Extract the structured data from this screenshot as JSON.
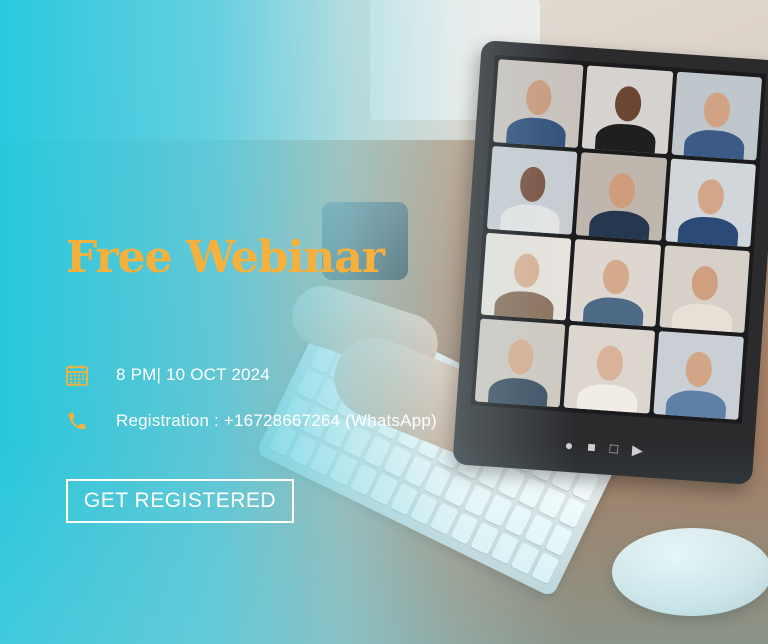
{
  "hero": {
    "title": "Free Webinar"
  },
  "details": {
    "date_icon": "calendar-icon",
    "date_text": "8 PM| 10 OCT 2024",
    "phone_icon": "phone-icon",
    "registration_text": "Registration :  +16728667264 (WhatsApp)"
  },
  "cta": {
    "label": "GET REGISTERED"
  },
  "colors": {
    "title": "#f6b13d",
    "overlay": "#26c8de",
    "icon": "#f6b13d",
    "text": "#ffffff"
  }
}
